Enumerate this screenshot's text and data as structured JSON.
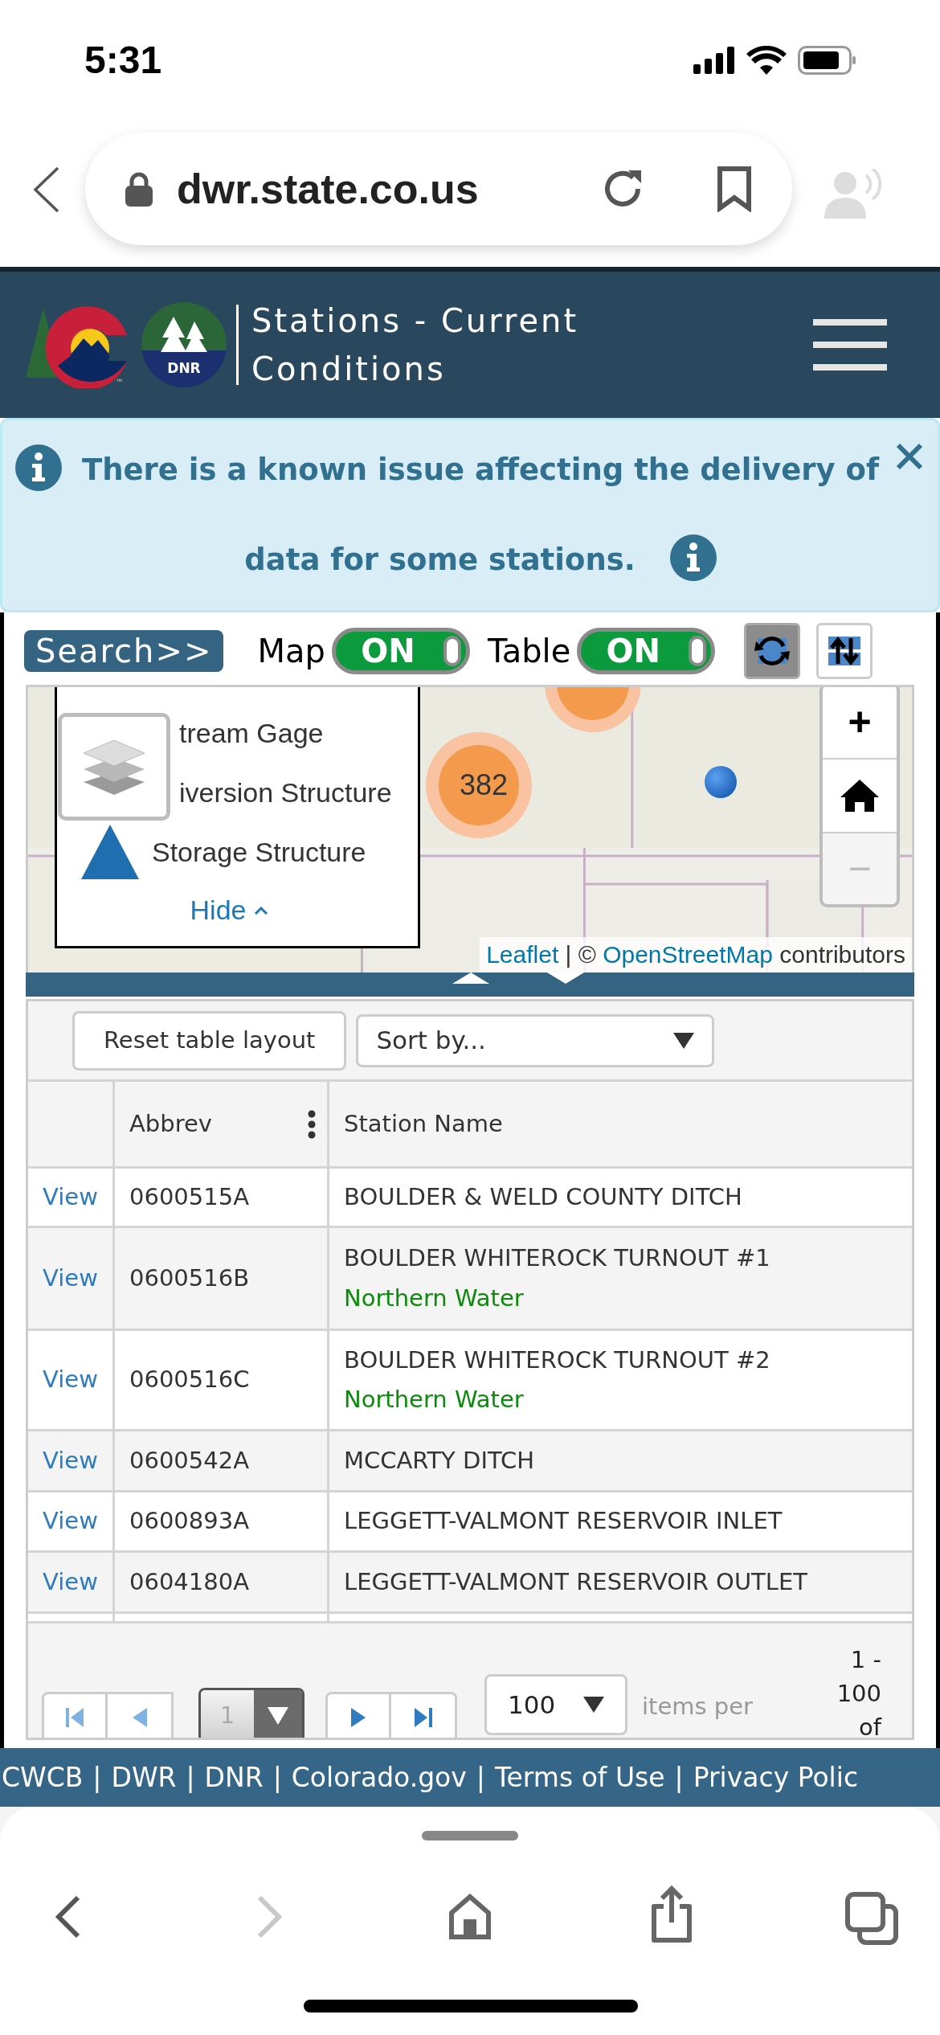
{
  "status_bar": {
    "time": "5:31"
  },
  "browser": {
    "url": "dwr.state.co.us"
  },
  "header": {
    "logo_mark": "DNR",
    "trademark": "™",
    "title": "Stations - Current Conditions"
  },
  "alert": {
    "message": "There is a known issue affecting the delivery of data for some stations."
  },
  "toolbar": {
    "search_button": "Search>>",
    "toggles": [
      {
        "label": "Map",
        "text": "ON",
        "on": true
      },
      {
        "label": "Table",
        "text": "ON",
        "on": true
      }
    ],
    "tools": [
      {
        "kind": "refresh",
        "pressed": true
      },
      {
        "kind": "swap",
        "pressed": false
      }
    ]
  },
  "map": {
    "legend": {
      "items": [
        {
          "kind": "gage",
          "label": "tream Gage"
        },
        {
          "kind": "diversion",
          "label": "iversion Structure"
        },
        {
          "kind": "storage",
          "label": "Storage Structure"
        }
      ],
      "hide_link": "Hide"
    },
    "cluster_count": "382",
    "zoom": {
      "zoom_in": "+",
      "zoom_out": "−",
      "zoom_out_disabled": true
    },
    "attribution": {
      "first_link": "Leaflet",
      "separator": "|",
      "copyright": "©",
      "second_link": "OpenStreetMap",
      "suffix": "contributors"
    }
  },
  "table": {
    "reset_button": "Reset table layout",
    "sort_select": "Sort by...",
    "columns": [
      {
        "label": "Abbrev",
        "menu": true
      },
      {
        "label": "Station Name",
        "menu": false
      }
    ],
    "rows": [
      {
        "link": "View",
        "abbrev": "0600515A",
        "name": "BOULDER & WELD COUNTY DITCH"
      },
      {
        "link": "View",
        "abbrev": "0600516B",
        "name": "BOULDER WHITEROCK TURNOUT #1",
        "operator": "Northern Water"
      },
      {
        "link": "View",
        "abbrev": "0600516C",
        "name": "BOULDER WHITEROCK TURNOUT #2",
        "operator": "Northern Water"
      },
      {
        "link": "View",
        "abbrev": "0600542A",
        "name": "MCCARTY DITCH"
      },
      {
        "link": "View",
        "abbrev": "0600893A",
        "name": "LEGGETT-VALMONT RESERVOIR INLET"
      },
      {
        "link": "View",
        "abbrev": "0604180A",
        "name": "LEGGETT-VALMONT RESERVOIR OUTLET"
      }
    ],
    "pager": {
      "page": "1",
      "page_size": "100",
      "items_label": "items per",
      "range": "1 - 100 of"
    }
  },
  "footer": {
    "links": [
      "CWCB",
      "DWR",
      "DNR",
      "Colorado.gov",
      "Terms of Use",
      "Privacy Polic"
    ],
    "separator": "|"
  },
  "bottom_bar": {
    "back_disabled": false,
    "forward_disabled": true
  }
}
